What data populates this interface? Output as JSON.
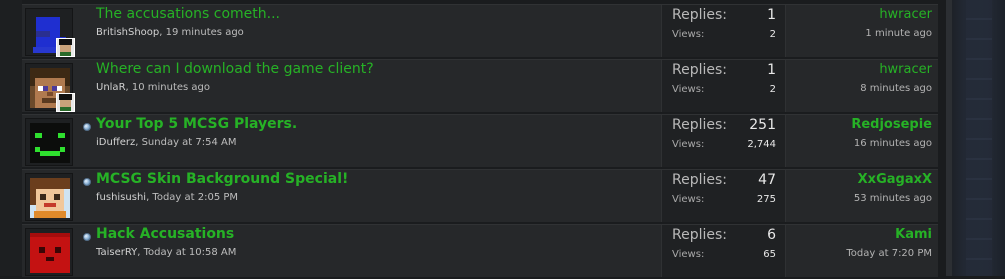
{
  "threads": [
    {
      "title": "The accusations cometh...",
      "starter": "BritishShoop",
      "started": ", 19 minutes ago",
      "avatar": "blue-block-avatar",
      "replies_label": "Replies:",
      "replies": "1",
      "views_label": "Views:",
      "views": "2",
      "last_user": "hwracer",
      "last_time": "1 minute ago"
    },
    {
      "title": "Where can I download the game client?",
      "starter": "UnlaR",
      "started": ", 10 minutes ago",
      "avatar": "steve-skin-avatar",
      "replies_label": "Replies:",
      "replies": "1",
      "views_label": "Views:",
      "views": "2",
      "last_user": "hwracer",
      "last_time": "8 minutes ago"
    },
    {
      "title": "Your Top 5 MCSG Players.",
      "starter": "iDufferz",
      "started": ", Sunday at 7:54 AM",
      "avatar": "green-smiley-avatar",
      "replies_label": "Replies:",
      "replies": "251",
      "views_label": "Views:",
      "views": "2,744",
      "last_user": "Redjosepie",
      "last_time": "16 minutes ago"
    },
    {
      "title": "MCSG Skin Background Special!",
      "starter": "fushisushi",
      "started": ", Today at 2:05 PM",
      "avatar": "cartoon-character-avatar",
      "replies_label": "Replies:",
      "replies": "47",
      "views_label": "Views:",
      "views": "275",
      "last_user": "XxGagaxX",
      "last_time": "53 minutes ago"
    },
    {
      "title": "Hack Accusations",
      "starter": "TaiserRY",
      "started": ", Today at 10:58 AM",
      "avatar": "red-block-avatar",
      "replies_label": "Replies:",
      "replies": "6",
      "views_label": "Views:",
      "views": "65",
      "last_user": "Kami",
      "last_time": "Today at 7:20 PM"
    }
  ],
  "colors": {
    "link_green": "#26b226",
    "background": "#1a1c1e",
    "row": "#26282a"
  }
}
